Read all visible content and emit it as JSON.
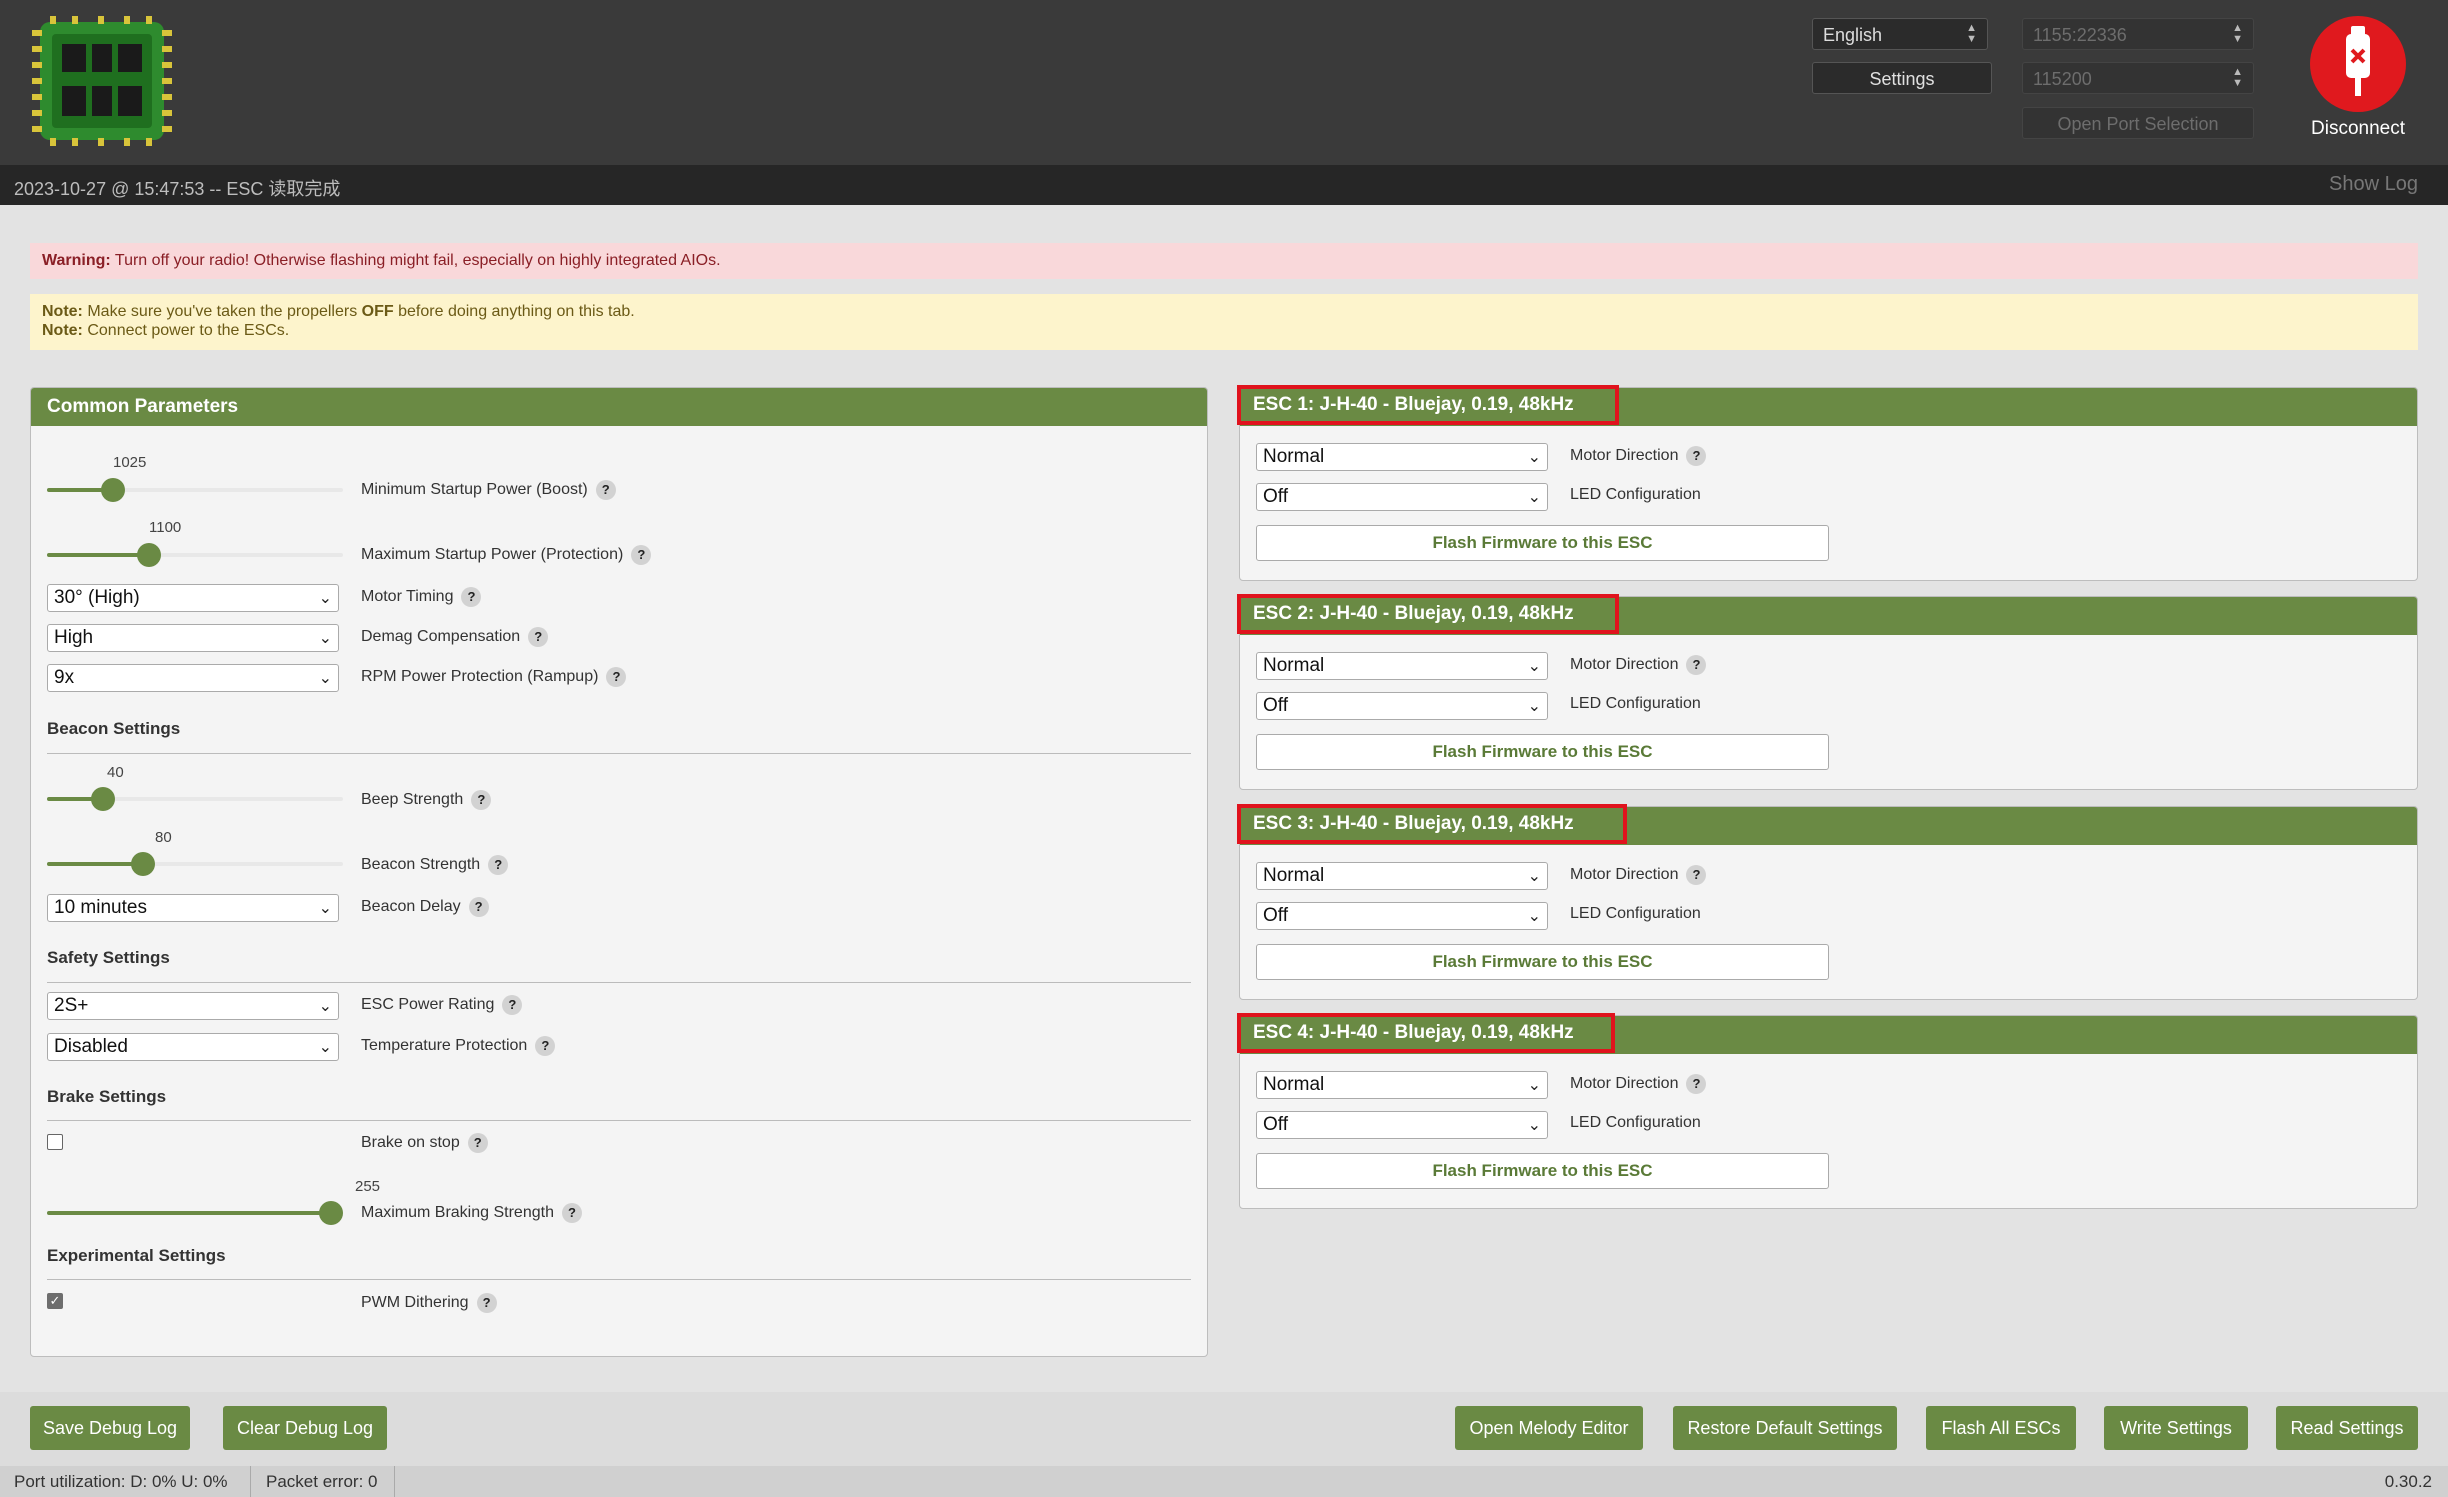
{
  "header": {
    "language": "English",
    "port": "1155:22336",
    "baud": "115200",
    "settings_label": "Settings",
    "open_port_label": "Open Port Selection",
    "disconnect_label": "Disconnect"
  },
  "log": {
    "message": "2023-10-27 @ 15:47:53 -- ESC 读取完成",
    "show_log": "Show Log"
  },
  "warning": {
    "prefix": "Warning:",
    "text": "Turn off your radio! Otherwise flashing might fail, especially on highly integrated AIOs."
  },
  "notes": {
    "prefix": "Note:",
    "line1_a": "Make sure you've taken the propellers",
    "line1_b": "OFF",
    "line1_c": "before doing anything on this tab.",
    "line2": "Connect power to the ESCs."
  },
  "common": {
    "title": "Common Parameters",
    "min_startup": {
      "value": "1025",
      "label": "Minimum Startup Power (Boost)",
      "fraction": 0.2
    },
    "max_startup": {
      "value": "1100",
      "label": "Maximum Startup Power (Protection)",
      "fraction": 0.33
    },
    "motor_timing": {
      "value": "30° (High)",
      "label": "Motor Timing"
    },
    "demag": {
      "value": "High",
      "label": "Demag Compensation"
    },
    "rampup": {
      "value": "9x",
      "label": "RPM Power Protection (Rampup)"
    },
    "beacon_section": "Beacon Settings",
    "beep_strength": {
      "value": "40",
      "label": "Beep Strength",
      "fraction": 0.16
    },
    "beacon_strength": {
      "value": "80",
      "label": "Beacon Strength",
      "fraction": 0.31
    },
    "beacon_delay": {
      "value": "10 minutes",
      "label": "Beacon Delay"
    },
    "safety_section": "Safety Settings",
    "power_rating": {
      "value": "2S+",
      "label": "ESC Power Rating"
    },
    "temp_protection": {
      "value": "Disabled",
      "label": "Temperature Protection"
    },
    "brake_section": "Brake Settings",
    "brake_on_stop": {
      "label": "Brake on stop",
      "checked": false
    },
    "max_braking": {
      "value": "255",
      "label": "Maximum Braking Strength",
      "fraction": 1.0
    },
    "experimental_section": "Experimental Settings",
    "pwm_dithering": {
      "label": "PWM Dithering",
      "checked": true
    }
  },
  "escs": [
    {
      "title": "ESC 1: J-H-40 - Bluejay, 0.19, 48kHz",
      "direction": "Normal",
      "led": "Off",
      "direction_label": "Motor Direction",
      "led_label": "LED Configuration",
      "flash": "Flash Firmware to this ESC"
    },
    {
      "title": "ESC 2: J-H-40 - Bluejay, 0.19, 48kHz",
      "direction": "Normal",
      "led": "Off",
      "direction_label": "Motor Direction",
      "led_label": "LED Configuration",
      "flash": "Flash Firmware to this ESC"
    },
    {
      "title": "ESC 3: J-H-40 - Bluejay, 0.19, 48kHz",
      "direction": "Normal",
      "led": "Off",
      "direction_label": "Motor Direction",
      "led_label": "LED Configuration",
      "flash": "Flash Firmware to this ESC"
    },
    {
      "title": "ESC 4: J-H-40 - Bluejay, 0.19, 48kHz",
      "direction": "Normal",
      "led": "Off",
      "direction_label": "Motor Direction",
      "led_label": "LED Configuration",
      "flash": "Flash Firmware to this ESC"
    }
  ],
  "bottom": {
    "save_debug": "Save Debug Log",
    "clear_debug": "Clear Debug Log",
    "melody": "Open Melody Editor",
    "restore": "Restore Default Settings",
    "flash_all": "Flash All ESCs",
    "write": "Write Settings",
    "read": "Read Settings"
  },
  "status": {
    "port_util": "Port utilization: D: 0% U: 0%",
    "packet_error": "Packet error: 0",
    "version": "0.30.2"
  },
  "colors": {
    "accent": "#6a8a44",
    "danger": "#e0191e",
    "highlight": "#e0131d"
  }
}
